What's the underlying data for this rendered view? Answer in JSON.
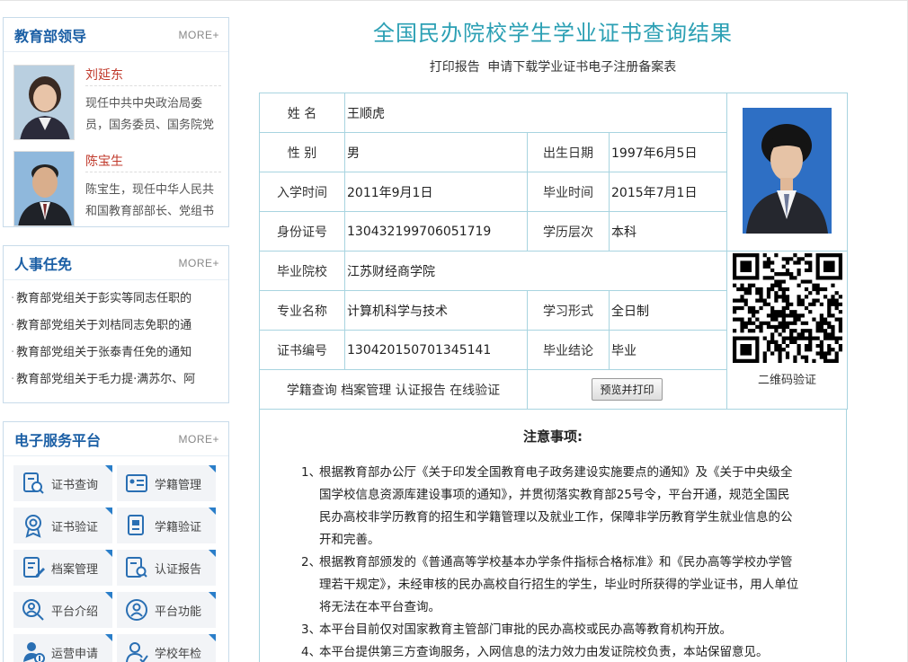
{
  "leaders": {
    "title": "教育部领导",
    "more": "MORE+",
    "people": [
      {
        "name": "刘延东",
        "desc": "现任中共中央政治局委员，国务委员、国务院党"
      },
      {
        "name": "陈宝生",
        "desc": "陈宝生，现任中华人民共和国教育部部长、党组书"
      }
    ]
  },
  "personnel": {
    "title": "人事任免",
    "more": "MORE+",
    "items": [
      "教育部党组关于彭实等同志任职的",
      "教育部党组关于刘桔同志免职的通",
      "教育部党组关于张泰青任免的通知",
      "教育部党组关于毛力提·满苏尔、阿"
    ]
  },
  "services": {
    "title": "电子服务平台",
    "more": "MORE+",
    "items": [
      {
        "label": "证书查询",
        "icon": "certificate-search-icon"
      },
      {
        "label": "学籍管理",
        "icon": "student-record-icon"
      },
      {
        "label": "证书验证",
        "icon": "badge-verify-icon"
      },
      {
        "label": "学籍验证",
        "icon": "record-verify-icon"
      },
      {
        "label": "档案管理",
        "icon": "archive-edit-icon"
      },
      {
        "label": "认证报告",
        "icon": "report-search-icon"
      },
      {
        "label": "平台介绍",
        "icon": "platform-intro-icon"
      },
      {
        "label": "平台功能",
        "icon": "platform-function-icon"
      },
      {
        "label": "运营申请",
        "icon": "apply-icon"
      },
      {
        "label": "学校年检",
        "icon": "school-check-icon"
      }
    ]
  },
  "main": {
    "title": "全国民办院校学生学业证书查询结果",
    "sub_links": [
      "打印报告",
      "申请下载学业证书电子注册备案表"
    ]
  },
  "record": {
    "name_label": "姓 名",
    "name": "王顺虎",
    "gender_label": "性 别",
    "gender": "男",
    "birth_label": "出生日期",
    "birth": "1997年6月5日",
    "enroll_label": "入学时间",
    "enroll": "2011年9月1日",
    "grad_label": "毕业时间",
    "grad": "2015年7月1日",
    "id_label": "身份证号",
    "id": "130432199706051719",
    "level_label": "学历层次",
    "level": "本科",
    "school_label": "毕业院校",
    "school": "江苏财经商学院",
    "major_label": "专业名称",
    "major": "计算机科学与技术",
    "mode_label": "学习形式",
    "mode": "全日制",
    "cert_label": "证书编号",
    "cert": "130420150701345141",
    "conclusion_label": "毕业结论",
    "conclusion": "毕业",
    "bottom_links": [
      "学籍查询",
      "档案管理",
      "认证报告",
      "在线验证"
    ],
    "print_button": "预览并打印",
    "qr_caption": "二维码验证"
  },
  "notice": {
    "title": "注意事项:",
    "items": [
      {
        "num": "1、",
        "text": "根据教育部办公厅《关于印发全国教育电子政务建设实施要点的通知》及《关于中央级全国学校信息资源库建设事项的通知》，并贯彻落实教育部25号令，平台开通，规范全国民民办高校非学历教育的招生和学籍管理以及就业工作，保障非学历教育学生就业信息的公开和完善。"
      },
      {
        "num": "2、",
        "text": "根据教育部颁发的《普通高等学校基本办学条件指标合格标准》和《民办高等学校办学管理若干规定》，未经审核的民办高校自行招生的学生，毕业时所获得的学业证书，用人单位将无法在本平台查询。"
      },
      {
        "num": "3、",
        "text": "本平台目前仅对国家教育主管部门审批的民办高校或民办高等教育机构开放。"
      },
      {
        "num": "4、",
        "text": "本平台提供第三方查询服务，入网信息的法力效力由发证院校负责，本站保留意见。"
      }
    ]
  }
}
